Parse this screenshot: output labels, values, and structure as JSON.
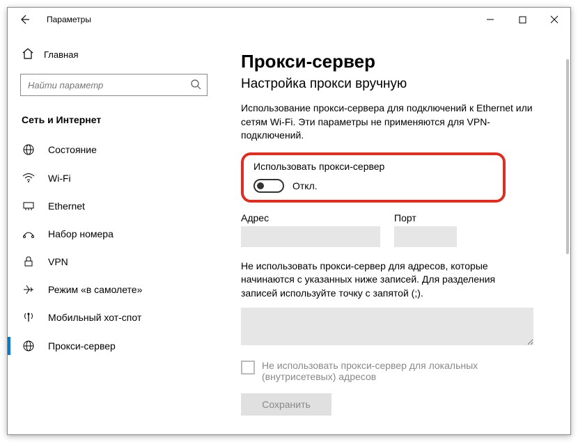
{
  "titlebar": {
    "title": "Параметры"
  },
  "sidebar": {
    "home": "Главная",
    "search_placeholder": "Найти параметр",
    "section": "Сеть и Интернет",
    "items": [
      {
        "label": "Состояние",
        "icon": "globe"
      },
      {
        "label": "Wi-Fi",
        "icon": "wifi"
      },
      {
        "label": "Ethernet",
        "icon": "ethernet"
      },
      {
        "label": "Набор номера",
        "icon": "dialup"
      },
      {
        "label": "VPN",
        "icon": "vpn"
      },
      {
        "label": "Режим «в самолете»",
        "icon": "airplane"
      },
      {
        "label": "Мобильный хот-спот",
        "icon": "hotspot"
      },
      {
        "label": "Прокси-сервер",
        "icon": "globe"
      }
    ]
  },
  "main": {
    "title": "Прокси-сервер",
    "subtitle": "Настройка прокси вручную",
    "description": "Использование прокси-сервера для подключений к Ethernet или сетям Wi-Fi. Эти параметры не применяются для VPN-подключений.",
    "toggle_label": "Использовать прокси-сервер",
    "toggle_state": "Откл.",
    "address_label": "Адрес",
    "port_label": "Порт",
    "exceptions_text": "Не использовать прокси-сервер для адресов, которые начинаются с указанных ниже записей. Для разделения записей используйте точку с запятой (;).",
    "local_checkbox_text": "Не использовать прокси-сервер для локальных (внутрисетевых) адресов",
    "save_button": "Сохранить"
  }
}
